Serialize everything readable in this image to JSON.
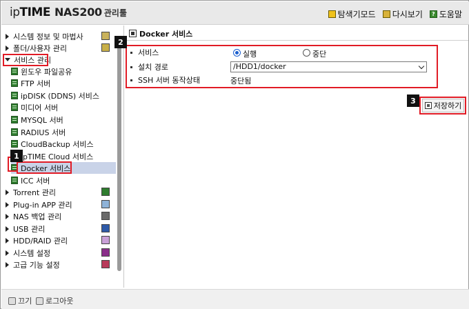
{
  "header": {
    "logo": {
      "ip": "ip",
      "time": "TIME",
      "model": "NAS200",
      "admin": "관리툴"
    },
    "nav": [
      {
        "label": "탐색기모드",
        "icon": "explorer-icon"
      },
      {
        "label": "다시보기",
        "icon": "refresh-icon"
      },
      {
        "label": "도움말",
        "icon": "help-icon"
      }
    ],
    "help_glyph": "?"
  },
  "sidebar": {
    "menus": [
      {
        "label": "시스템 정보 및 마법사",
        "icon": "chart-icon",
        "icon_color": "#b8a048"
      },
      {
        "label": "폴더/사용자 관리",
        "icon": "users-icon",
        "icon_color": "#c8b04a"
      },
      {
        "label": "서비스 관리",
        "expanded": true
      },
      {
        "label": "Torrent 관리",
        "icon": "torrent-icon",
        "icon_color": "#2f7d2f"
      },
      {
        "label": "Plug-in APP 관리",
        "icon": "plugin-icon",
        "icon_color": "#8fb3d8"
      },
      {
        "label": "NAS 백업 관리",
        "icon": "backup-icon",
        "icon_color": "#6a6a6a"
      },
      {
        "label": "USB 관리",
        "icon": "usb-icon",
        "icon_color": "#2e5aa8"
      },
      {
        "label": "HDD/RAID 관리",
        "icon": "hdd-icon",
        "icon_color": "#c9a0d8"
      },
      {
        "label": "시스템 설정",
        "icon": "settings-icon",
        "icon_color": "#8a2e8a"
      },
      {
        "label": "고급 기능 설정",
        "icon": "advanced-icon",
        "icon_color": "#b83a5a"
      }
    ],
    "services": [
      "윈도우 파일공유",
      "FTP 서버",
      "ipDISK (DDNS) 서비스",
      "미디어 서버",
      "MYSQL 서버",
      "RADIUS 서버",
      "CloudBackup 서비스",
      "ipTIME Cloud 서비스",
      "Docker 서비스",
      "ICC 서버"
    ],
    "selected_service": "Docker 서비스"
  },
  "content": {
    "title": "Docker 서비스",
    "rows": {
      "service": {
        "label": "서비스",
        "options": [
          "실행",
          "중단"
        ],
        "selected": "실행"
      },
      "install_path": {
        "label": "설치 경로",
        "value": "/HDD1/docker"
      },
      "ssh_status": {
        "label": "SSH 서버 동작상태",
        "value": "중단됨"
      }
    },
    "save_label": "저장하기"
  },
  "footer": {
    "power_label": "끄기",
    "logout_label": "로그아웃"
  },
  "annotations": {
    "badge1": "1",
    "badge2": "2",
    "badge3": "3",
    "highlight_color": "#e11b25"
  }
}
